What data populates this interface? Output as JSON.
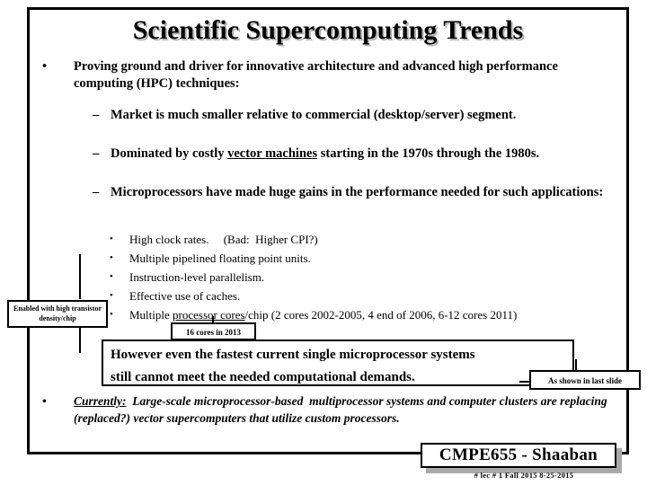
{
  "slide": {
    "title": "Scientific Supercomputing Trends",
    "bullet1": {
      "marker": "•",
      "text": "Proving ground and driver for innovative architecture and advanced high performance computing (HPC) techniques:"
    },
    "sub_bullets": [
      {
        "marker": "–",
        "text": "Market is much smaller relative to commercial (desktop/server) segment."
      },
      {
        "marker": "–",
        "text_before": "Dominated by costly ",
        "underlined": "vector machines",
        "text_after": " starting in the 1970s through the 1980s."
      },
      {
        "marker": "–",
        "text": "Microprocessors have made huge gains in the performance needed for such applications:"
      }
    ],
    "level3_bullets": [
      {
        "marker": "•",
        "text": "High clock rates.     (Bad:  Higher CPI?)"
      },
      {
        "marker": "•",
        "text": "Multiple pipelined floating point units."
      },
      {
        "marker": "•",
        "text": "Instruction-level parallelism."
      },
      {
        "marker": "•",
        "text": "Effective use of caches."
      },
      {
        "marker": "•",
        "text_before": "Multiple ",
        "underlined": "processor cores",
        "text_after": "/chip  (2 cores 2002-2005, 4 end of 2006, 6-12 cores 2011)"
      }
    ],
    "callouts": {
      "transistor_density": "Enabled with high transistor density/chip",
      "cores_2013": "16 cores in 2013",
      "last_slide": "As shown in last slide"
    },
    "however_box": {
      "line1": "However even the fastest current single microprocessor systems",
      "line2": "still cannot meet the needed computational demands."
    },
    "currently_bullet": {
      "marker": "•",
      "label": "Currently:",
      "text": "  Large-scale microprocessor-based  multiprocessor systems and computer clusters are replacing (replaced?) vector supercomputers that utilize custom processors."
    },
    "footer": {
      "course": "CMPE655 - Shaaban",
      "note": "#  lec # 1   Fall 2015   8-25-2015"
    },
    "colors": {
      "text": "#000000",
      "background": "#ffffff",
      "title_shadow": "#b3b3b3",
      "plaque_shadow": "#a9a9a9"
    }
  }
}
